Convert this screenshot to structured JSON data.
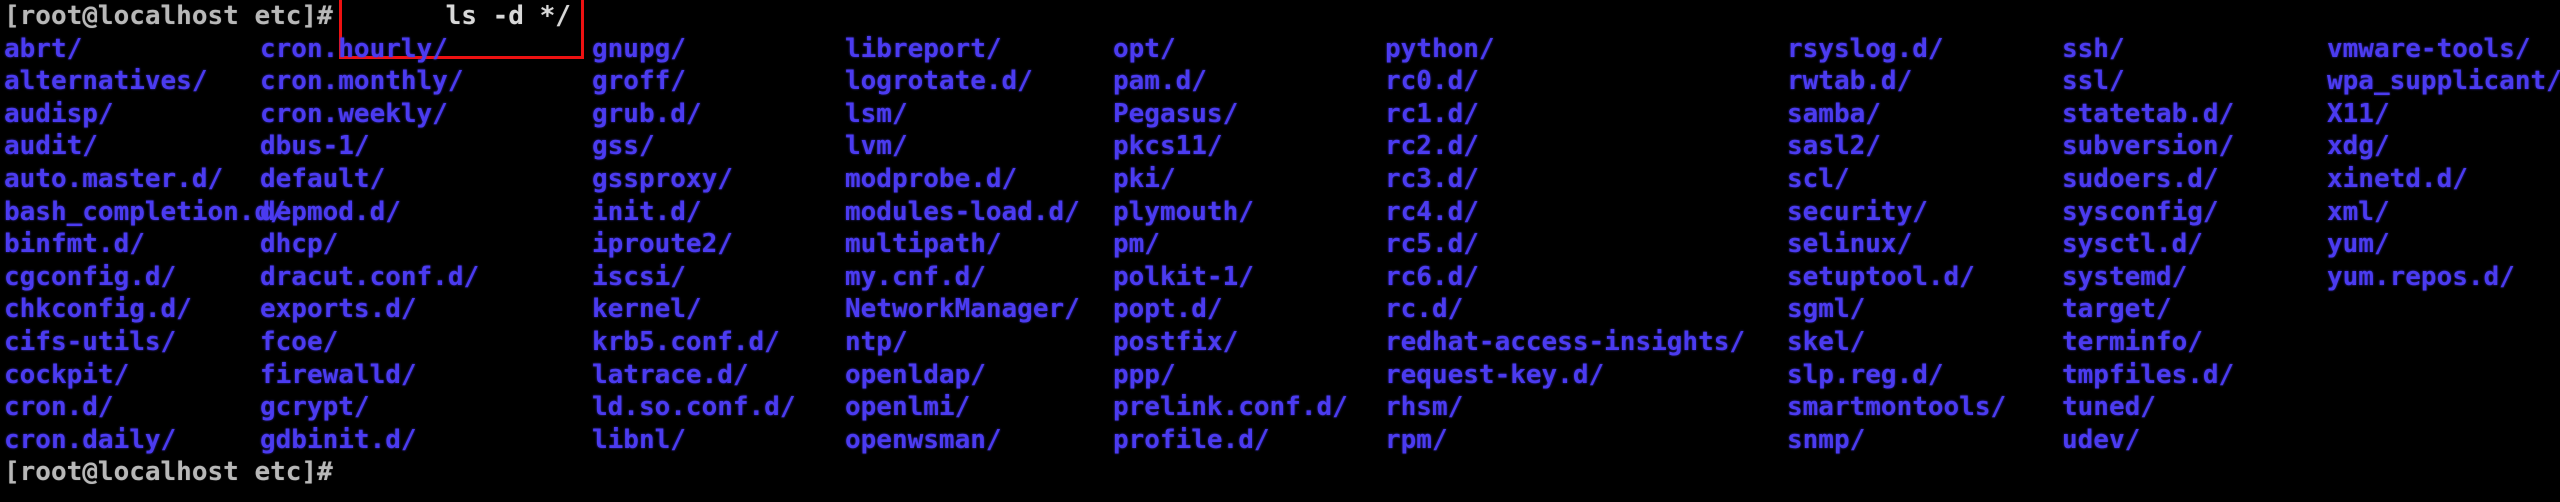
{
  "terminal": {
    "colors": {
      "background": "#000000",
      "directory_text": "#4b3bf0",
      "prompt_text": "#b8b8b8",
      "annotation_box": "#ee1111"
    },
    "prompt_top": "[root@localhost etc]#",
    "command": "ls -d */",
    "prompt_bottom": "[root@localhost etc]#",
    "listing": {
      "columns": 9,
      "rows": 14,
      "grid": [
        [
          "abrt/",
          "cron.hourly/",
          "gnupg/",
          "libreport/",
          "opt/",
          "python/",
          "rsyslog.d/",
          "ssh/",
          "vmware-tools/"
        ],
        [
          "alternatives/",
          "cron.monthly/",
          "groff/",
          "logrotate.d/",
          "pam.d/",
          "rc0.d/",
          "rwtab.d/",
          "ssl/",
          "wpa_supplicant/"
        ],
        [
          "audisp/",
          "cron.weekly/",
          "grub.d/",
          "lsm/",
          "Pegasus/",
          "rc1.d/",
          "samba/",
          "statetab.d/",
          "X11/"
        ],
        [
          "audit/",
          "dbus-1/",
          "gss/",
          "lvm/",
          "pkcs11/",
          "rc2.d/",
          "sasl2/",
          "subversion/",
          "xdg/"
        ],
        [
          "auto.master.d/",
          "default/",
          "gssproxy/",
          "modprobe.d/",
          "pki/",
          "rc3.d/",
          "scl/",
          "sudoers.d/",
          "xinetd.d/"
        ],
        [
          "bash_completion.d/",
          "depmod.d/",
          "init.d/",
          "modules-load.d/",
          "plymouth/",
          "rc4.d/",
          "security/",
          "sysconfig/",
          "xml/"
        ],
        [
          "binfmt.d/",
          "dhcp/",
          "iproute2/",
          "multipath/",
          "pm/",
          "rc5.d/",
          "selinux/",
          "sysctl.d/",
          "yum/"
        ],
        [
          "cgconfig.d/",
          "dracut.conf.d/",
          "iscsi/",
          "my.cnf.d/",
          "polkit-1/",
          "rc6.d/",
          "setuptool.d/",
          "systemd/",
          "yum.repos.d/"
        ],
        [
          "chkconfig.d/",
          "exports.d/",
          "kernel/",
          "NetworkManager/",
          "popt.d/",
          "rc.d/",
          "sgml/",
          "target/",
          ""
        ],
        [
          "cifs-utils/",
          "fcoe/",
          "krb5.conf.d/",
          "ntp/",
          "postfix/",
          "redhat-access-insights/",
          "skel/",
          "terminfo/",
          ""
        ],
        [
          "cockpit/",
          "firewalld/",
          "latrace.d/",
          "openldap/",
          "ppp/",
          "request-key.d/",
          "slp.reg.d/",
          "tmpfiles.d/",
          ""
        ],
        [
          "cron.d/",
          "gcrypt/",
          "ld.so.conf.d/",
          "openlmi/",
          "prelink.conf.d/",
          "rhsm/",
          "smartmontools/",
          "tuned/",
          ""
        ],
        [
          "cron.daily/",
          "gdbinit.d/",
          "libnl/",
          "openwsman/",
          "profile.d/",
          "rpm/",
          "snmp/",
          "udev/",
          ""
        ]
      ]
    }
  }
}
